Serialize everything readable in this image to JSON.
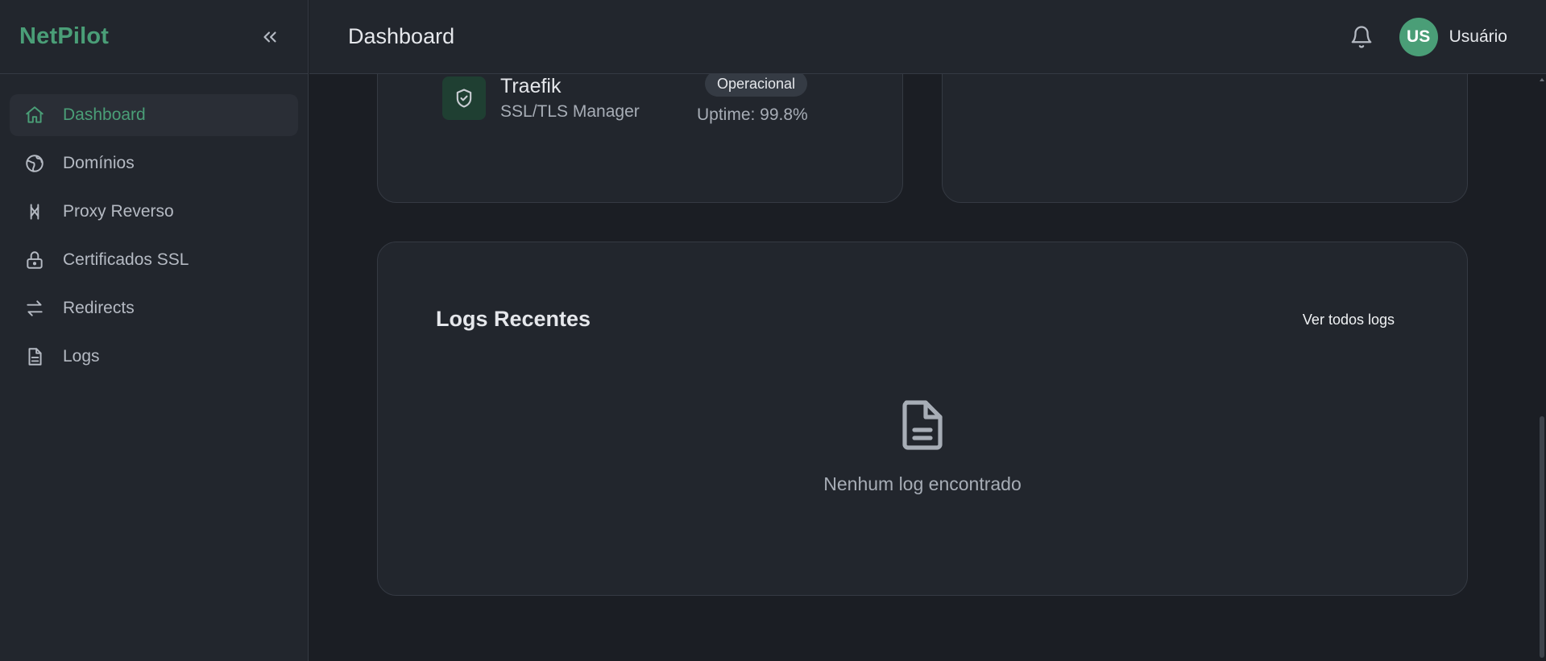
{
  "app": {
    "name": "NetPilot"
  },
  "sidebar": {
    "items": [
      {
        "label": "Dashboard",
        "icon": "home-icon",
        "active": true
      },
      {
        "label": "Domínios",
        "icon": "globe-icon"
      },
      {
        "label": "Proxy Reverso",
        "icon": "proxy-icon"
      },
      {
        "label": "Certificados SSL",
        "icon": "lock-icon"
      },
      {
        "label": "Redirects",
        "icon": "arrows-icon"
      },
      {
        "label": "Logs",
        "icon": "document-icon"
      }
    ]
  },
  "header": {
    "title": "Dashboard",
    "user_initials": "US",
    "user_name": "Usuário"
  },
  "service": {
    "name": "Traefik",
    "description": "SSL/TLS Manager",
    "status": "Operacional",
    "uptime": "Uptime: 99.8%"
  },
  "logs": {
    "title": "Logs Recentes",
    "view_all": "Ver todos logs",
    "empty_message": "Nenhum log encontrado"
  },
  "colors": {
    "accent": "#4a9e77",
    "background": "#1b1e24",
    "surface": "#22262d"
  }
}
